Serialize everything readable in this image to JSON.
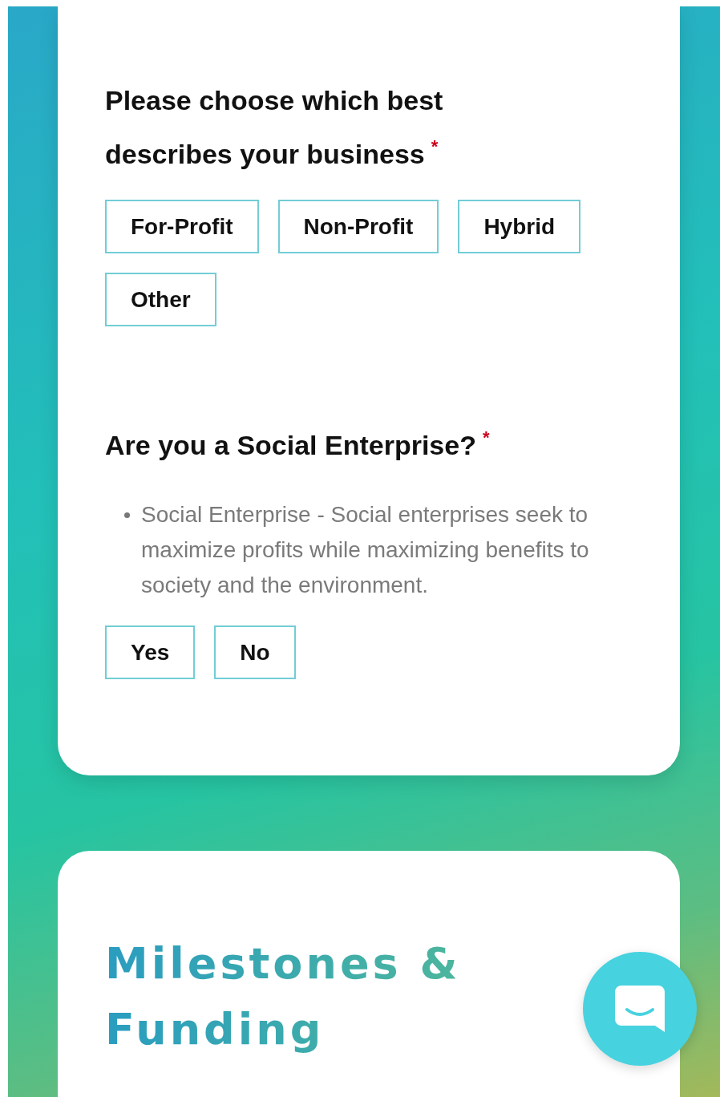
{
  "questions": [
    {
      "title": "Please choose which best describes your business",
      "required_mark": "*",
      "options": [
        {
          "label": "For-Profit",
          "selected": false
        },
        {
          "label": "Non-Profit",
          "selected": false
        },
        {
          "label": "Hybrid",
          "selected": false
        },
        {
          "label": "Other",
          "selected": false
        }
      ]
    },
    {
      "title": "Are you a Social Enterprise?",
      "required_mark": "*",
      "bullets": [
        "Social Enterprise - Social enterprises seek to maximize profits while maximizing benefits to society and the environment."
      ],
      "options": [
        {
          "label": "Yes",
          "selected": false
        },
        {
          "label": "No",
          "selected": false
        }
      ]
    }
  ],
  "section": {
    "title": "Milestones & Funding"
  }
}
